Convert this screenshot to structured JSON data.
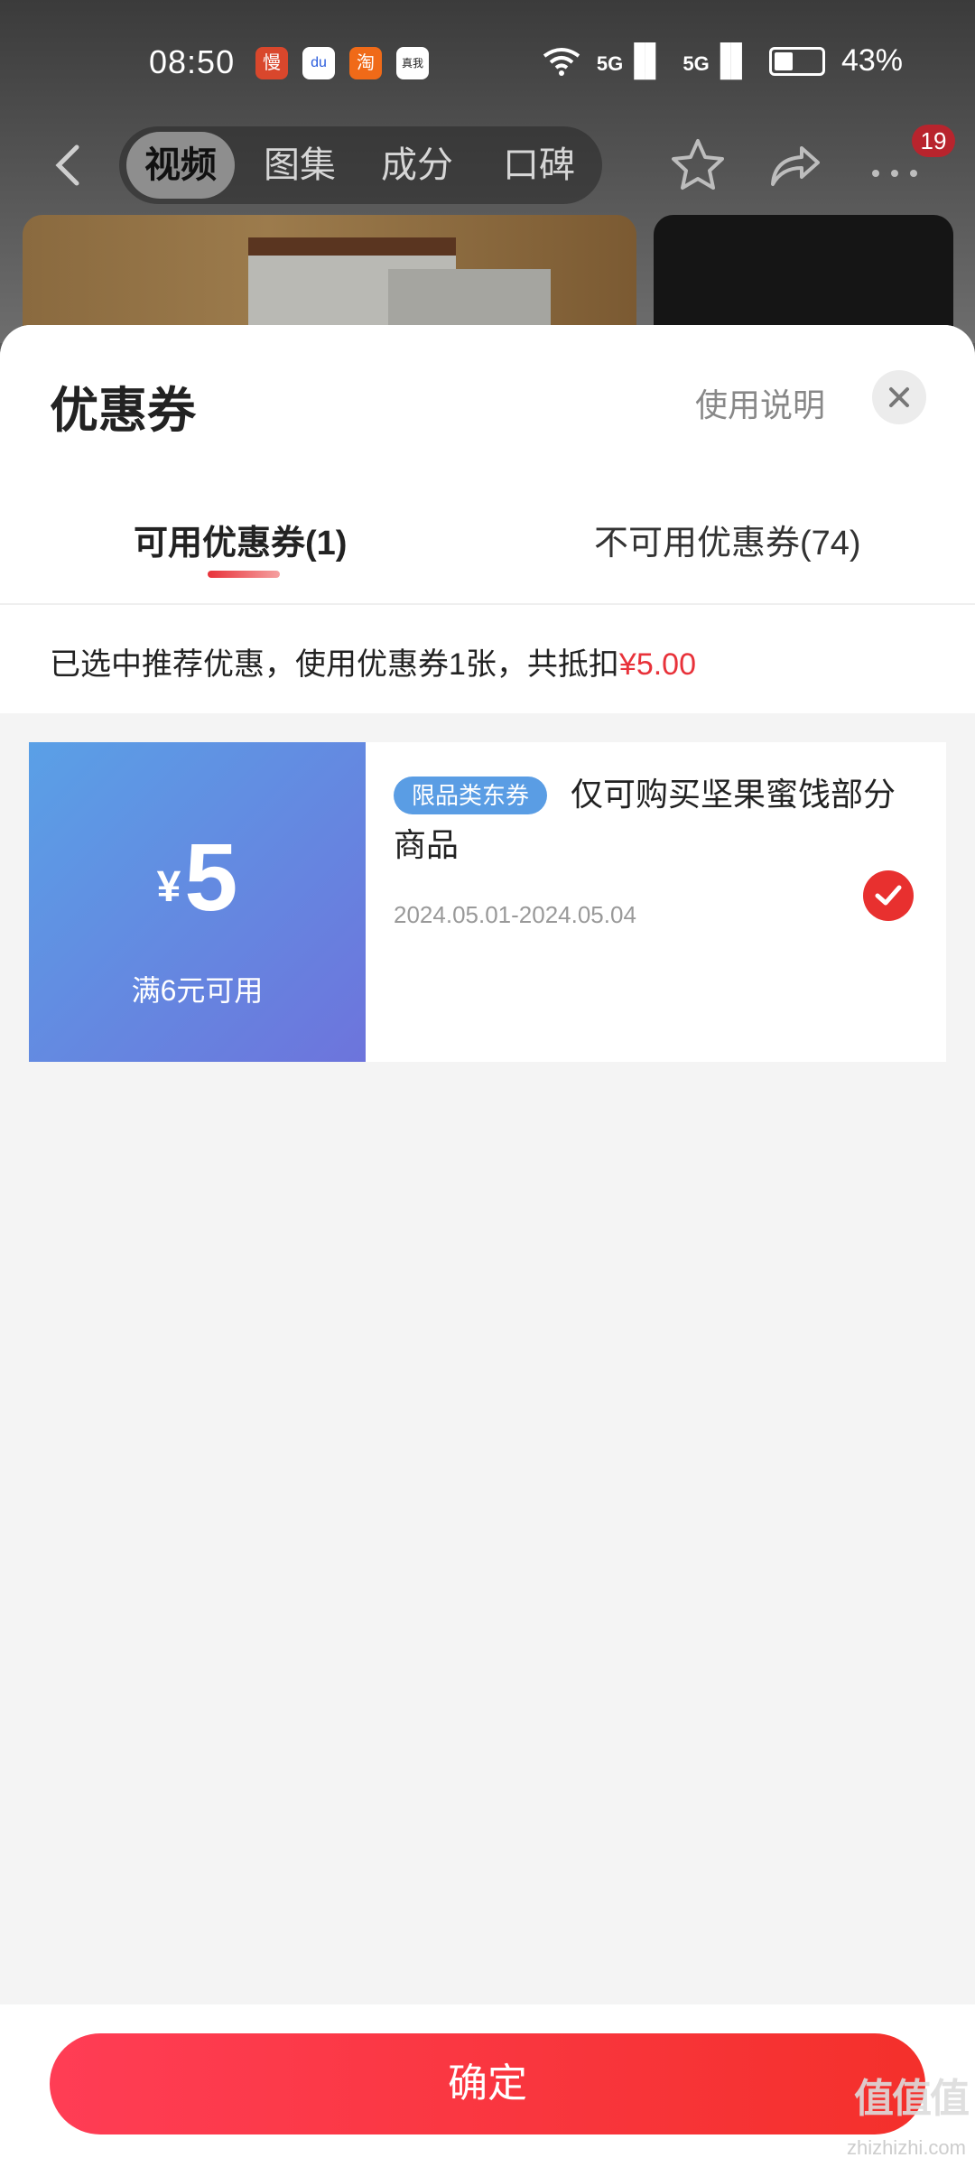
{
  "status_bar": {
    "time": "08:50",
    "app_icons": [
      "慢",
      "du",
      "淘",
      "真我"
    ],
    "signal_1": "5G",
    "signal_2": "5G",
    "battery": "43%"
  },
  "nav": {
    "tabs": [
      {
        "label": "视频",
        "active": true
      },
      {
        "label": "图集",
        "active": false
      },
      {
        "label": "成分",
        "active": false
      },
      {
        "label": "口碑",
        "active": false
      }
    ],
    "badge_count": "19",
    "icons": [
      "back-icon",
      "star-icon",
      "share-icon",
      "more-icon"
    ]
  },
  "sheet": {
    "title": "优惠券",
    "usage_link": "使用说明",
    "tab_available": "可用优惠券(1)",
    "tab_unavailable": "不可用优惠券(74)",
    "summary_prefix": "已选中推荐优惠，使用优惠券1张，共抵扣",
    "summary_amount": "¥5.00",
    "coupon": {
      "currency": "¥",
      "amount": "5",
      "condition": "满6元可用",
      "tag": "限品类东券",
      "description": "仅可购买坚果蜜饯部分商品",
      "date_range": "2024.05.01-2024.05.04",
      "selected": true
    },
    "confirm_label": "确定"
  },
  "colors": {
    "accent_red": "#e8323a",
    "coupon_blue": "#5a9de4",
    "button_gradient_start": "#ff3d55",
    "button_gradient_end": "#f4302b"
  },
  "watermark": {
    "logo": "值值值",
    "site": "zhizhizhi.com"
  }
}
